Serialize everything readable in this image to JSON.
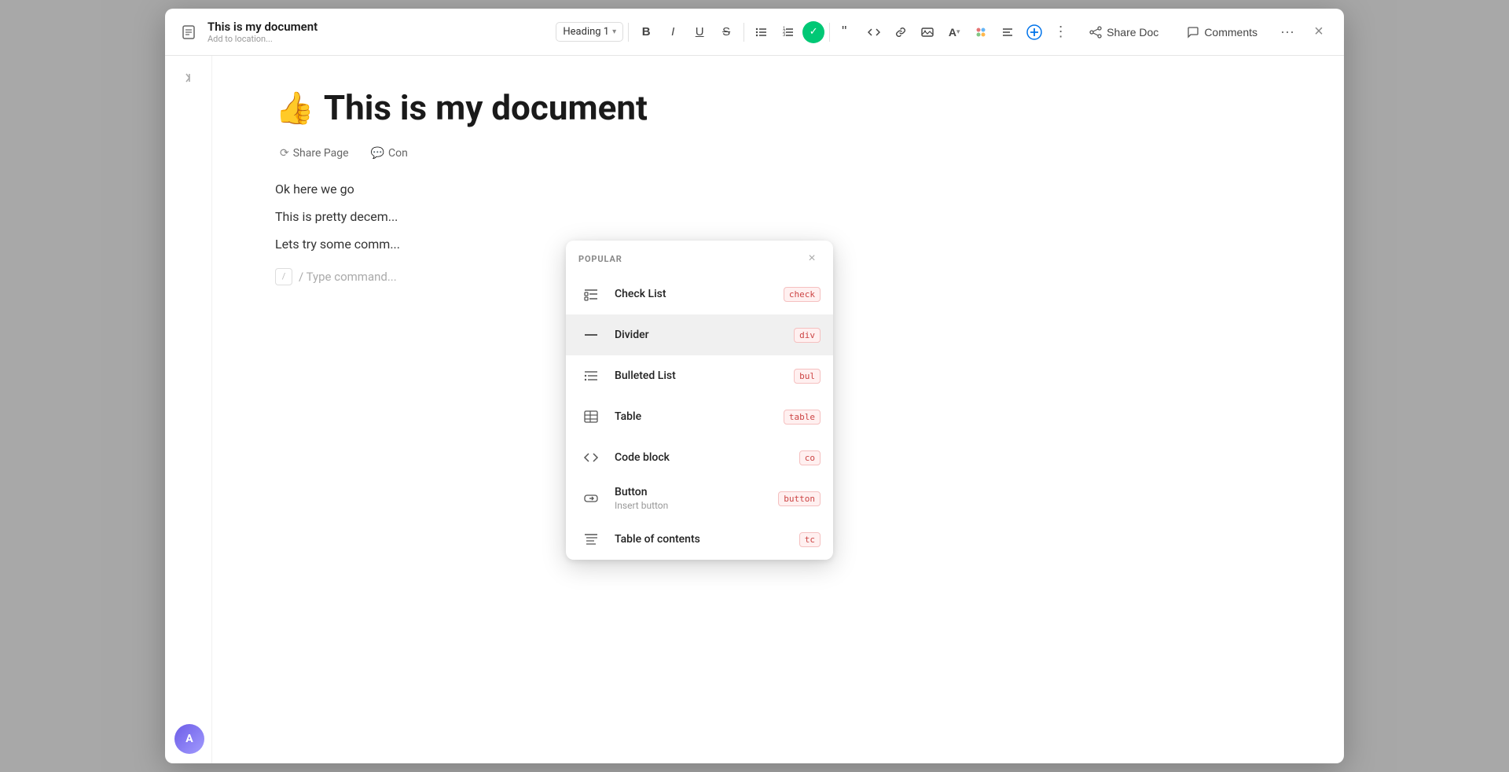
{
  "window": {
    "title": "This is my document",
    "subtitle": "Add to location...",
    "close_label": "×"
  },
  "toolbar": {
    "heading_select": "Heading 1",
    "bold_label": "B",
    "italic_label": "I",
    "underline_label": "U",
    "strikethrough_label": "S",
    "check_icon": "✓",
    "share_doc_label": "Share Doc",
    "comments_label": "Comments",
    "more_label": "···"
  },
  "editor": {
    "emoji": "👍",
    "heading": "This is my document",
    "inline_buttons": [
      {
        "icon": "⟳",
        "label": "Share Page"
      },
      {
        "icon": "💬",
        "label": "Con"
      }
    ],
    "paragraphs": [
      "Ok here we go",
      "This is pretty decem...",
      "Lets try some comm..."
    ],
    "command_placeholder": "/ Type command..."
  },
  "popup": {
    "section_label": "POPULAR",
    "items": [
      {
        "icon": "checklist",
        "label": "Check List",
        "sublabel": "",
        "shortcut": "check"
      },
      {
        "icon": "divider",
        "label": "Divider",
        "sublabel": "",
        "shortcut": "div"
      },
      {
        "icon": "bulleted",
        "label": "Bulleted List",
        "sublabel": "",
        "shortcut": "bul"
      },
      {
        "icon": "table",
        "label": "Table",
        "sublabel": "",
        "shortcut": "table"
      },
      {
        "icon": "code",
        "label": "Code block",
        "sublabel": "",
        "shortcut": "co"
      },
      {
        "icon": "button",
        "label": "Button",
        "sublabel": "Insert button",
        "shortcut": "button"
      },
      {
        "icon": "toc",
        "label": "Table of contents",
        "sublabel": "",
        "shortcut": "tc"
      }
    ]
  },
  "colors": {
    "accent_green": "#00c875",
    "shortcut_text": "#cc4444",
    "shortcut_bg": "#fff0f0"
  }
}
